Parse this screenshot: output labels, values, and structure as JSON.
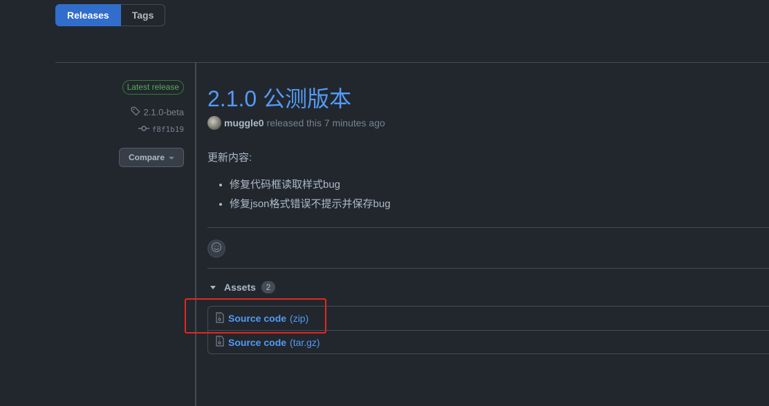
{
  "subnav": {
    "releases_label": "Releases",
    "tags_label": "Tags"
  },
  "release_meta": {
    "latest_label": "Latest release",
    "tag": "2.1.0-beta",
    "commit": "f8f1b19",
    "compare_label": "Compare"
  },
  "release": {
    "title": "2.1.0 公测版本",
    "author": "muggle0",
    "released_text": "released this 7 minutes ago",
    "notes_heading": "更新内容:",
    "notes": [
      "修复代码框读取样式bug",
      "修复json格式错误不提示并保存bug"
    ]
  },
  "assets": {
    "label": "Assets",
    "count": "2",
    "items": [
      {
        "name": "Source code",
        "ext": "(zip)"
      },
      {
        "name": "Source code",
        "ext": "(tar.gz)"
      }
    ]
  },
  "colors": {
    "background": "#22272e",
    "accent_blue": "#539bf5",
    "selected_tab": "#316dca",
    "latest_green": "#57ab5a",
    "annotation_red": "#e5281c"
  },
  "icons": {
    "tag": "tag-icon",
    "commit": "git-commit-icon",
    "reaction": "smiley-icon",
    "file_zip": "file-zip-icon"
  }
}
